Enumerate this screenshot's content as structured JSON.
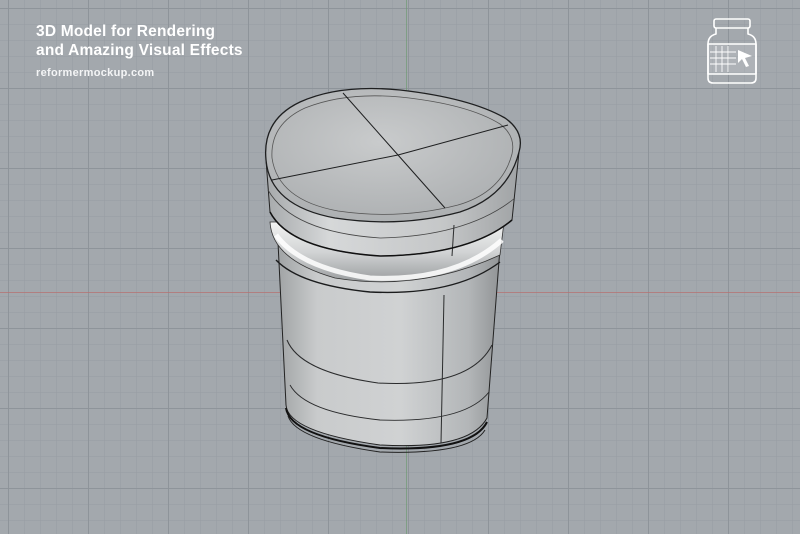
{
  "header": {
    "title_line1": "3D Model for Rendering",
    "title_line2": "and Amazing Visual Effects",
    "website": "reformermockup.com"
  },
  "logo": {
    "icon": "jar-mockup-logo-icon"
  },
  "viewport": {
    "background_color": "#a3a8ad",
    "grid_color": "#8c9298",
    "x_axis_color": "#b57272",
    "y_axis_color": "#6f9a74"
  },
  "model": {
    "object": "jar-3d-wireframe",
    "surface_color": "#c4c6c7",
    "edge_color": "#1e1f20"
  }
}
